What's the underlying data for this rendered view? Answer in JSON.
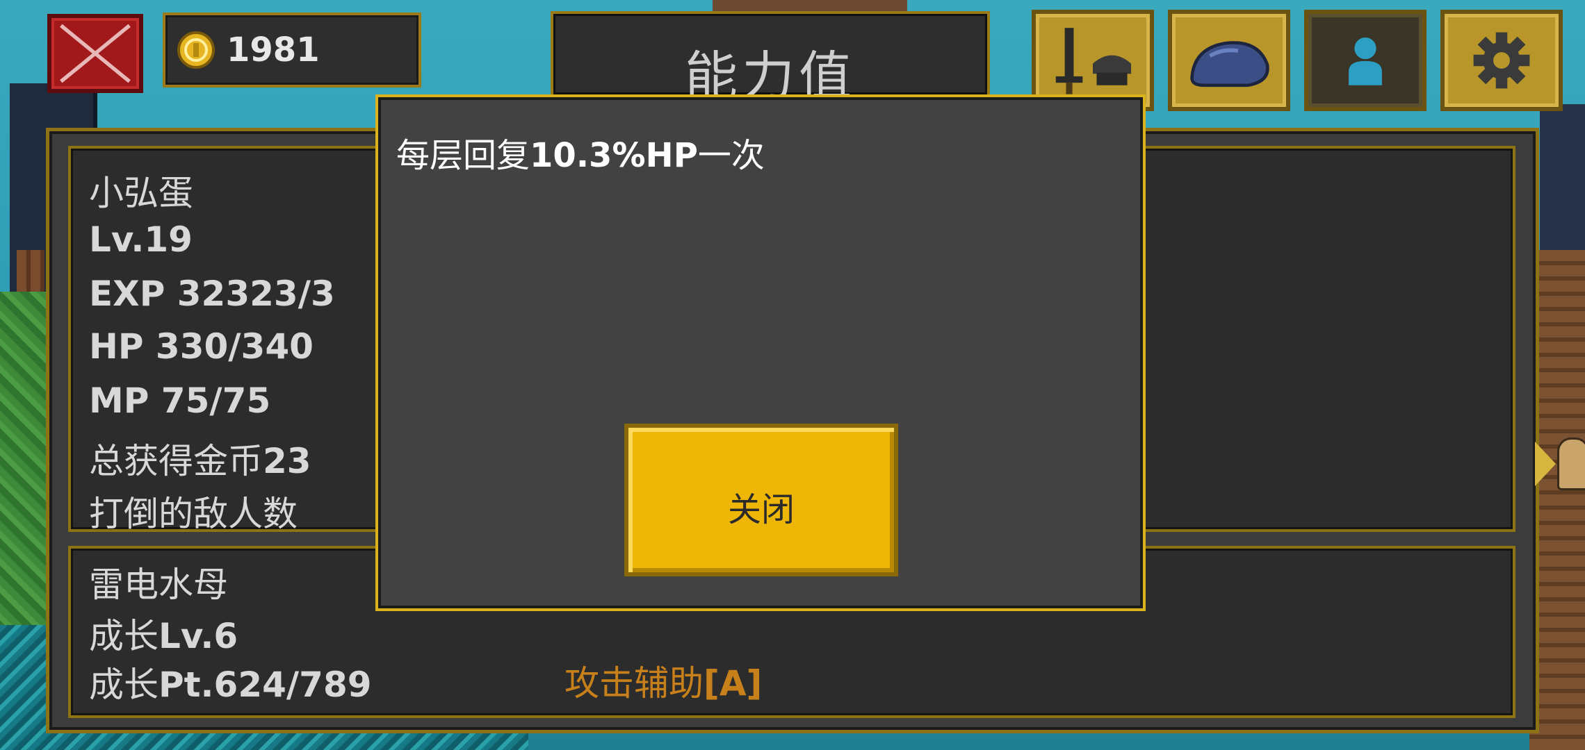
{
  "top_bar": {
    "coins": "1981",
    "title": "能力值",
    "tabs": [
      {
        "icon": "equipment-icon",
        "active": false
      },
      {
        "icon": "stone-icon",
        "active": false
      },
      {
        "icon": "character-icon",
        "active": true
      },
      {
        "icon": "gear-icon",
        "active": false
      }
    ]
  },
  "character": {
    "name": "小弘蛋",
    "level": "Lv.19",
    "exp": "EXP 32323/3",
    "hp": "HP 330/340",
    "mp": "MP 75/75",
    "gold_label": "总获得金币",
    "gold_value": "23",
    "kills_label": "打倒的敌人数"
  },
  "pet": {
    "name": "雷电水母",
    "growth_label": "成长",
    "growth_level": "Lv.6",
    "growth_points": "Pt.624/789",
    "skill_label": "攻击辅助",
    "skill_rank": "[A]"
  },
  "modal": {
    "text_prefix": "每层回复",
    "text_value": "10.3%HP",
    "text_suffix": "一次",
    "close_label": "关闭"
  },
  "colors": {
    "gold_border": "#8d7314",
    "button_yellow": "#eeb606",
    "skill_orange": "#c8801a",
    "exit_red": "#a2191b"
  }
}
